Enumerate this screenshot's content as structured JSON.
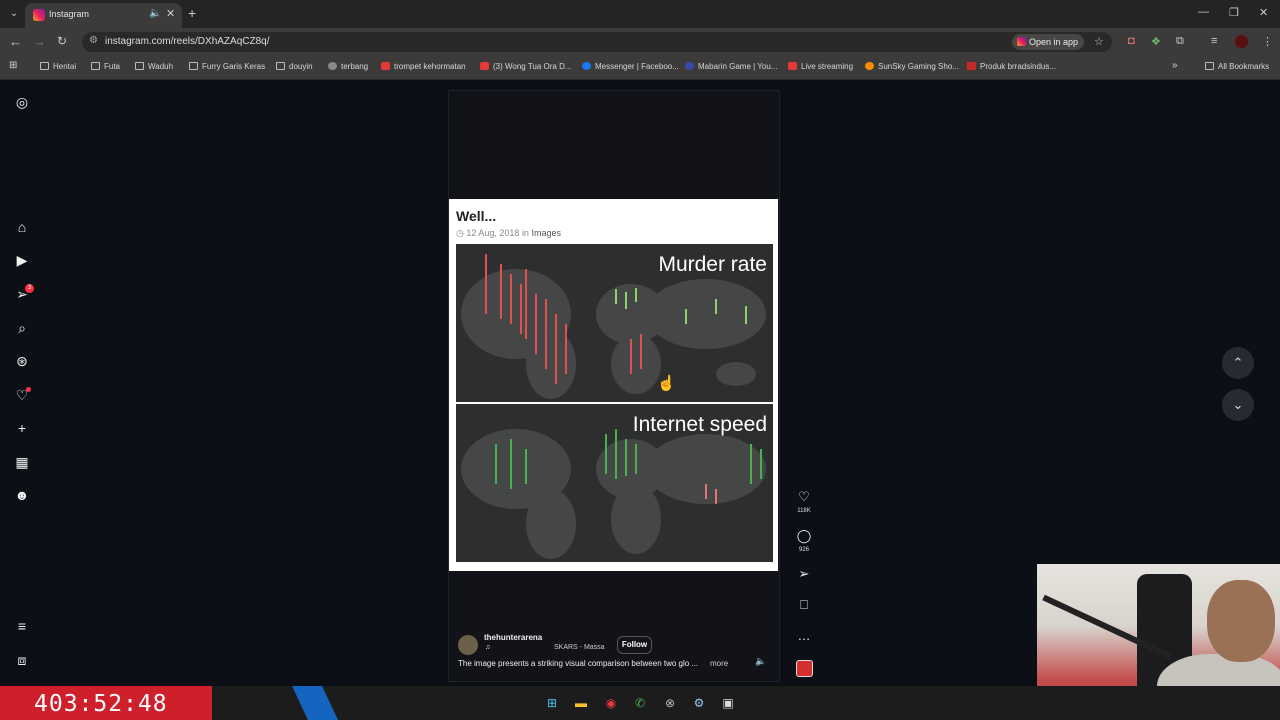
{
  "browser": {
    "tab_title": "Instagram",
    "url": "instagram.com/reels/DXhAZAqCZ8q/",
    "open_in_app": "Open in app",
    "bookmarks": [
      "Hentai",
      "Futa",
      "Waduh",
      "Furry Garis Keras",
      "douyin",
      "terbang",
      "trompet kehormatan",
      "(3) Wong Tua Ora D...",
      "Messenger | Faceboo...",
      "Mabarin Game | You...",
      "Live streaming",
      "SunSky Gaming Sho...",
      "Produk brradsindus..."
    ],
    "all_bookmarks": "All Bookmarks"
  },
  "post": {
    "title": "Well...",
    "date": "12 Aug, 2018",
    "in_word": "in",
    "category": "Images",
    "map1_label": "Murder rate",
    "map2_label": "Internet speed"
  },
  "actions": {
    "likes": "118K",
    "comments": "926"
  },
  "reel": {
    "username": "thehunterarena",
    "audio": "SKARS - Massa",
    "follow": "Follow",
    "caption": "The image presents a striking visual comparison between two glo ...",
    "more": "more"
  },
  "overlay": {
    "timer": "403:52:48"
  },
  "colors": {
    "instagram_red": "#ff3040",
    "timer_bg": "#cf1f2b"
  }
}
